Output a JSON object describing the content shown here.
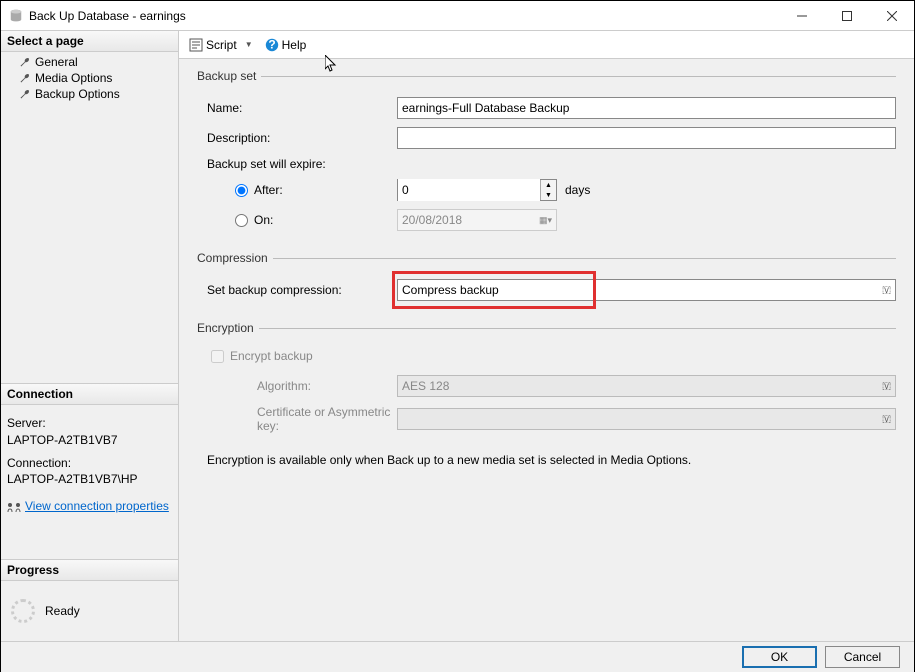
{
  "window": {
    "title": "Back Up Database - earnings"
  },
  "sidebar": {
    "select_header": "Select a page",
    "items": [
      "General",
      "Media Options",
      "Backup Options"
    ],
    "connection_header": "Connection",
    "server_label": "Server:",
    "server_value": "LAPTOP-A2TB1VB7",
    "connection_label": "Connection:",
    "connection_value": "LAPTOP-A2TB1VB7\\HP",
    "view_props": "View connection properties",
    "progress_header": "Progress",
    "progress_status": "Ready"
  },
  "toolbar": {
    "script": "Script",
    "help": "Help"
  },
  "form": {
    "backup_set_legend": "Backup set",
    "name_label": "Name:",
    "name_value": "earnings-Full Database Backup",
    "desc_label": "Description:",
    "desc_value": "",
    "expire_label": "Backup set will expire:",
    "after_label": "After:",
    "after_value": "0",
    "days_label": "days",
    "on_label": "On:",
    "on_value": "20/08/2018",
    "compression_legend": "Compression",
    "compression_label": "Set backup compression:",
    "compression_value": "Compress backup",
    "encryption_legend": "Encryption",
    "encrypt_label": "Encrypt backup",
    "algorithm_label": "Algorithm:",
    "algorithm_value": "AES 128",
    "cert_label": "Certificate or Asymmetric key:",
    "cert_value": "",
    "note": "Encryption is available only when Back up to a new media set is selected in Media Options."
  },
  "footer": {
    "ok": "OK",
    "cancel": "Cancel"
  }
}
